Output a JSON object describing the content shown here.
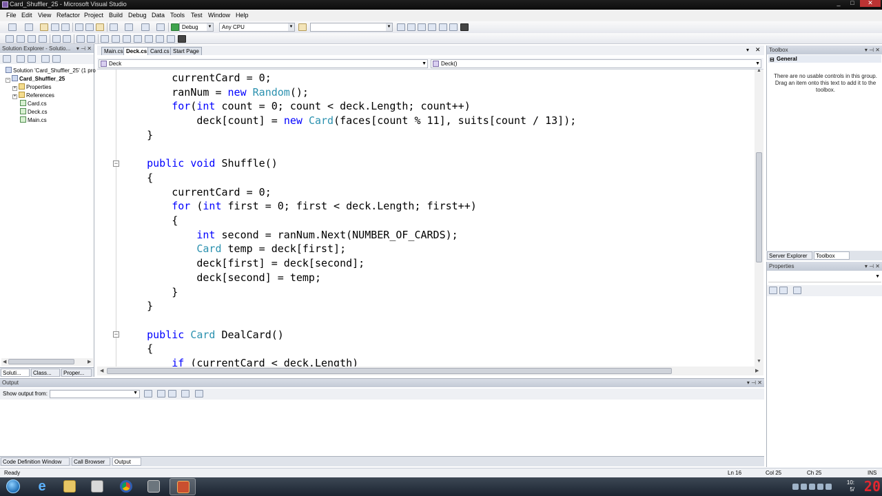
{
  "window": {
    "title": "Card_Shuffler_25 - Microsoft Visual Studio",
    "controls": [
      "_",
      "□",
      "✕"
    ]
  },
  "menu": [
    "File",
    "Edit",
    "View",
    "Refactor",
    "Project",
    "Build",
    "Debug",
    "Data",
    "Tools",
    "Test",
    "Window",
    "Help"
  ],
  "toolbar": {
    "configuration": "Debug",
    "platform": "Any CPU"
  },
  "solution_explorer": {
    "header": "Solution Explorer - Solutio...",
    "tree": [
      {
        "label": "Solution 'Card_Shuffler_25' (1 pro",
        "icon": "solution-icon"
      },
      {
        "label": "Card_Shuffler_25",
        "icon": "project-icon"
      },
      {
        "label": "Properties",
        "icon": "folder-icon"
      },
      {
        "label": "References",
        "icon": "folder-icon"
      },
      {
        "label": "Card.cs",
        "icon": "cs-file-icon"
      },
      {
        "label": "Deck.cs",
        "icon": "cs-file-icon"
      },
      {
        "label": "Main.cs",
        "icon": "cs-file-icon"
      }
    ],
    "tabs": [
      "Soluti...",
      "Class...",
      "Proper..."
    ]
  },
  "editor": {
    "tabs": [
      "Main.cs",
      "Deck.cs",
      "Card.cs",
      "Start Page"
    ],
    "active_tab": "Deck.cs",
    "type_dropdown": "Deck",
    "member_dropdown": "Deck()",
    "code_lines": [
      [
        {
          "t": "        currentCard = 0;",
          "c": ""
        }
      ],
      [
        {
          "t": "        ranNum = ",
          "c": ""
        },
        {
          "t": "new",
          "c": "kw"
        },
        {
          "t": " ",
          "c": ""
        },
        {
          "t": "Random",
          "c": "ty"
        },
        {
          "t": "();",
          "c": ""
        }
      ],
      [
        {
          "t": "        ",
          "c": ""
        },
        {
          "t": "for",
          "c": "kw"
        },
        {
          "t": "(",
          "c": ""
        },
        {
          "t": "int",
          "c": "kw"
        },
        {
          "t": " count = 0; count < deck.Length; count++)",
          "c": ""
        }
      ],
      [
        {
          "t": "            deck[count] = ",
          "c": ""
        },
        {
          "t": "new",
          "c": "kw"
        },
        {
          "t": " ",
          "c": ""
        },
        {
          "t": "Card",
          "c": "ty"
        },
        {
          "t": "(faces[count % 11], suits[count / 13]);",
          "c": ""
        }
      ],
      [
        {
          "t": "    }",
          "c": ""
        }
      ],
      [
        {
          "t": "",
          "c": ""
        }
      ],
      [
        {
          "t": "    ",
          "c": ""
        },
        {
          "t": "public",
          "c": "kw"
        },
        {
          "t": " ",
          "c": ""
        },
        {
          "t": "void",
          "c": "kw"
        },
        {
          "t": " Shuffle()",
          "c": ""
        }
      ],
      [
        {
          "t": "    {",
          "c": ""
        }
      ],
      [
        {
          "t": "        currentCard = 0;",
          "c": ""
        }
      ],
      [
        {
          "t": "        ",
          "c": ""
        },
        {
          "t": "for",
          "c": "kw"
        },
        {
          "t": " (",
          "c": ""
        },
        {
          "t": "int",
          "c": "kw"
        },
        {
          "t": " first = 0; first < deck.Length; first++)",
          "c": ""
        }
      ],
      [
        {
          "t": "        {",
          "c": ""
        }
      ],
      [
        {
          "t": "            ",
          "c": ""
        },
        {
          "t": "int",
          "c": "kw"
        },
        {
          "t": " second = ranNum.Next(NUMBER_OF_CARDS);",
          "c": ""
        }
      ],
      [
        {
          "t": "            ",
          "c": ""
        },
        {
          "t": "Card",
          "c": "ty"
        },
        {
          "t": " temp = deck[first];",
          "c": ""
        }
      ],
      [
        {
          "t": "            deck[first] = deck[second];",
          "c": ""
        }
      ],
      [
        {
          "t": "            deck[second] = temp;",
          "c": ""
        }
      ],
      [
        {
          "t": "        }",
          "c": ""
        }
      ],
      [
        {
          "t": "    }",
          "c": ""
        }
      ],
      [
        {
          "t": "",
          "c": ""
        }
      ],
      [
        {
          "t": "    ",
          "c": ""
        },
        {
          "t": "public",
          "c": "kw"
        },
        {
          "t": " ",
          "c": ""
        },
        {
          "t": "Card",
          "c": "ty"
        },
        {
          "t": " DealCard()",
          "c": ""
        }
      ],
      [
        {
          "t": "    {",
          "c": ""
        }
      ],
      [
        {
          "t": "        ",
          "c": ""
        },
        {
          "t": "if",
          "c": "kw"
        },
        {
          "t": " (currentCard < deck.Length)",
          "c": ""
        }
      ]
    ],
    "colors": {
      "keyword": "#0000ff",
      "type": "#2b91af",
      "text": "#000000"
    }
  },
  "output": {
    "header": "Output",
    "show_label": "Show output from:",
    "tabs": [
      "Code Definition Window",
      "Call Browser",
      "Output"
    ]
  },
  "toolbox": {
    "header": "Toolbox",
    "group": "General",
    "empty_text": "There are no usable controls in this group. Drag an item onto this text to add it to the toolbox.",
    "tabs": [
      "Server Explorer",
      "Toolbox"
    ]
  },
  "properties": {
    "header": "Properties"
  },
  "status": {
    "ready": "Ready",
    "ln": "Ln 16",
    "col": "Col 25",
    "ch": "Ch 25",
    "ins": "INS"
  },
  "taskbar": {
    "apps": [
      "internet-explorer-icon",
      "file-explorer-icon",
      "media-player-icon",
      "chrome-icon",
      "video-capture-icon",
      "visual-studio-icon"
    ],
    "clock_time": "10:",
    "clock_date": "5/",
    "overlay": "20"
  }
}
